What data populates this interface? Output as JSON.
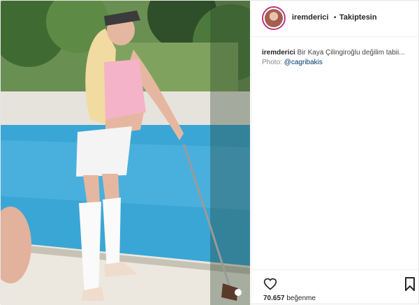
{
  "header": {
    "username": "iremderici",
    "separator": "•",
    "follow_status": "Takiptesin"
  },
  "caption": {
    "username": "iremderici",
    "text": "Bir Kaya Çilingiroğlu değilim tabii...",
    "photo_label": "Photo:",
    "photo_handle": "@cagribakis"
  },
  "footer": {
    "like_count": "70.657",
    "like_label": "beğenme"
  },
  "icons": {
    "heart": "heart-icon",
    "bookmark": "bookmark-icon",
    "avatar": "avatar"
  },
  "colors": {
    "accent": "#c13584",
    "handle": "#003569"
  }
}
